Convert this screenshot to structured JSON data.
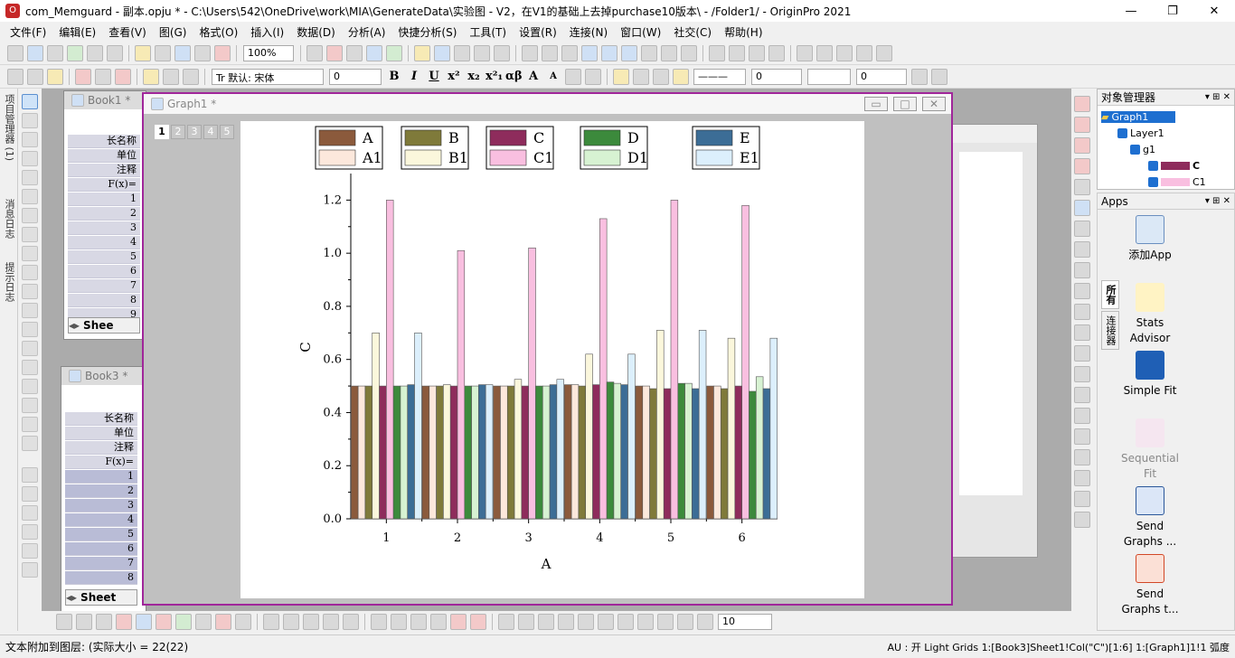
{
  "window": {
    "title": "com_Memguard - 副本.opju * - C:\\Users\\542\\OneDrive\\work\\MIA\\GenerateData\\实验图 - V2，在V1的基础上去掉purchase10版本\\ - /Folder1/ - OriginPro 2021",
    "app_icon": "origin-icon",
    "controls": [
      "—",
      "❐",
      "✕"
    ]
  },
  "menu": [
    "文件(F)",
    "编辑(E)",
    "查看(V)",
    "图(G)",
    "格式(O)",
    "插入(I)",
    "数据(D)",
    "分析(A)",
    "快捷分析(S)",
    "工具(T)",
    "设置(R)",
    "连接(N)",
    "窗口(W)",
    "社交(C)",
    "帮助(H)"
  ],
  "toolbar": {
    "zoom": "100%",
    "font": "Tr 默认: 宋体",
    "font_size": "0",
    "format_buttons": [
      "B",
      "I",
      "U",
      "x²",
      "x₂",
      "x²₁",
      "αβ",
      "A",
      "A"
    ],
    "line_width": "0",
    "line_width2": "0",
    "bottom_size": "10"
  },
  "left_tabs": [
    "项目管理器 (1)",
    "消息日志",
    "提示日志"
  ],
  "book1": {
    "title": "Book1 *",
    "rows": [
      "长名称",
      "单位",
      "注释",
      "F(x)=",
      "1",
      "2",
      "3",
      "4",
      "5",
      "6",
      "7",
      "8",
      "9"
    ],
    "sheet_tab": "Shee"
  },
  "book3": {
    "title": "Book3 *",
    "rows": [
      "长名称",
      "单位",
      "注释",
      "F(x)=",
      "1",
      "2",
      "3",
      "4",
      "5",
      "6",
      "7",
      "8"
    ],
    "sheet_tab": "Sheet"
  },
  "graph": {
    "title": "Graph1 *",
    "layers": [
      "1",
      "2",
      "3",
      "4",
      "5"
    ],
    "active_layer": "1"
  },
  "object_manager": {
    "title": "对象管理器",
    "items": [
      "Graph1",
      "Layer1",
      "g1",
      "C",
      "C1"
    ]
  },
  "apps": {
    "title": "Apps",
    "side_tabs": [
      "所有",
      "连接器"
    ],
    "items": [
      {
        "label": "添加App",
        "icon": "add-app-icon"
      },
      {
        "label": "Stats Advisor",
        "icon": "magic-wand-icon"
      },
      {
        "label": "Simple Fit",
        "icon": "fit-curve-icon"
      },
      {
        "label": "Sequential Fit",
        "icon": "sequential-fit-icon",
        "disabled": true
      },
      {
        "label": "Send Graphs ...",
        "icon": "send-word-icon"
      },
      {
        "label": "Send Graphs t...",
        "icon": "send-ppt-icon"
      }
    ]
  },
  "status": {
    "left": "文本附加到图层: (实际大小 = 22(22)",
    "right": "AU : 开  Light Grids  1:[Book3]Sheet1!Col(\"C\")[1:6]  1:[Graph1]1!1  弧度"
  },
  "chart_data": {
    "type": "bar",
    "xlabel": "A",
    "ylabel": "C",
    "categories": [
      "1",
      "2",
      "3",
      "4",
      "5",
      "6"
    ],
    "ylim": [
      0,
      1.3
    ],
    "yticks": [
      "0.0",
      "0.2",
      "0.4",
      "0.6",
      "0.8",
      "1.0",
      "1.2"
    ],
    "legend_placement": "top",
    "series": [
      {
        "name": "A",
        "color": "#8B5A3C",
        "values": [
          0.5,
          0.5,
          0.5,
          0.505,
          0.5,
          0.5
        ]
      },
      {
        "name": "A1",
        "color": "#FCE8DC",
        "values": [
          0.5,
          0.5,
          0.5,
          0.505,
          0.5,
          0.5
        ]
      },
      {
        "name": "B",
        "color": "#7F7A3A",
        "values": [
          0.5,
          0.5,
          0.5,
          0.5,
          0.49,
          0.49
        ]
      },
      {
        "name": "B1",
        "color": "#FBF7DC",
        "values": [
          0.7,
          0.505,
          0.525,
          0.62,
          0.71,
          0.68
        ]
      },
      {
        "name": "C",
        "color": "#8E2C5C",
        "values": [
          0.5,
          0.5,
          0.5,
          0.505,
          0.49,
          0.5
        ]
      },
      {
        "name": "C1",
        "color": "#F9BFE0",
        "values": [
          1.2,
          1.01,
          1.02,
          1.13,
          1.2,
          1.18
        ]
      },
      {
        "name": "D",
        "color": "#3C8A3C",
        "values": [
          0.5,
          0.5,
          0.5,
          0.515,
          0.51,
          0.48
        ]
      },
      {
        "name": "D1",
        "color": "#D7F2D2",
        "values": [
          0.5,
          0.5,
          0.5,
          0.51,
          0.51,
          0.535
        ]
      },
      {
        "name": "E",
        "color": "#3C6D96",
        "values": [
          0.505,
          0.505,
          0.505,
          0.505,
          0.49,
          0.49
        ]
      },
      {
        "name": "E1",
        "color": "#DCEFFC",
        "values": [
          0.7,
          0.505,
          0.525,
          0.62,
          0.71,
          0.68
        ]
      }
    ]
  }
}
